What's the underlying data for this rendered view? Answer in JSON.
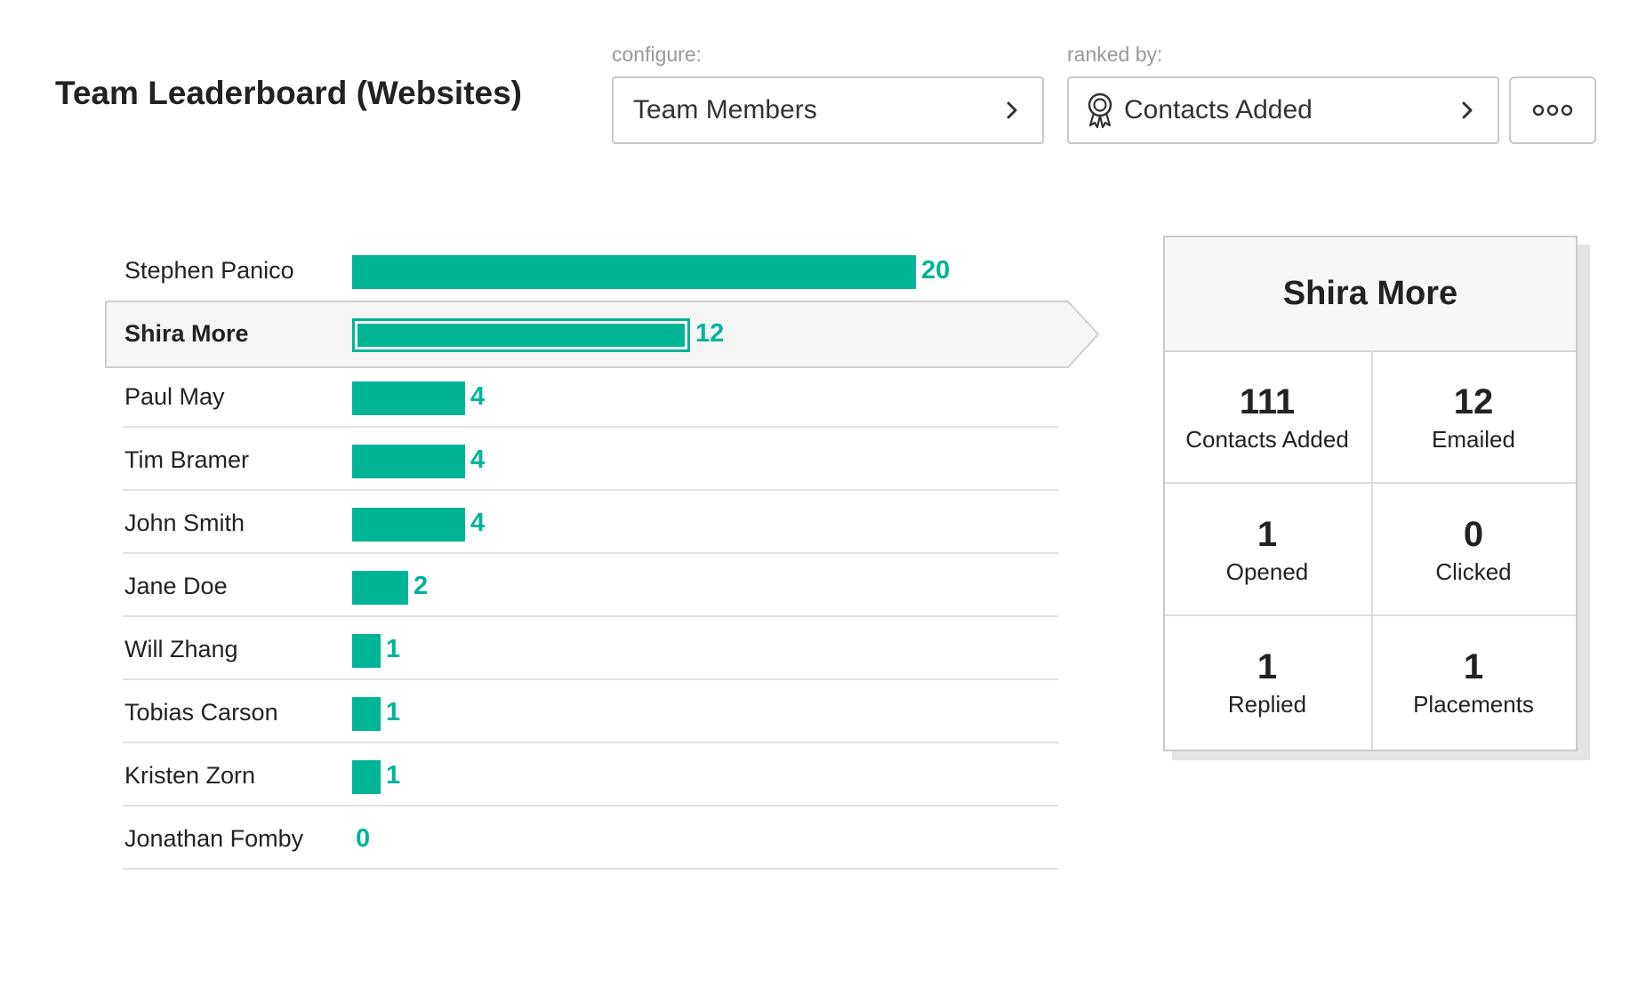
{
  "header": {
    "title": "Team Leaderboard (Websites)",
    "configure_label": "configure:",
    "configure_value": "Team Members",
    "ranked_label": "ranked by:",
    "ranked_value": "Contacts Added",
    "ranked_icon": "award-ribbon-icon",
    "more_icon": "more-options-icon"
  },
  "colors": {
    "accent": "#00b496",
    "selected_bg": "#f5f5f5",
    "border": "#c8c8c8"
  },
  "chart_data": {
    "type": "bar",
    "orientation": "horizontal",
    "categories": [
      "Stephen Panico",
      "Shira More",
      "Paul May",
      "Tim Bramer",
      "John Smith",
      "Jane Doe",
      "Will Zhang",
      "Tobias Carson",
      "Kristen Zorn",
      "Jonathan Fomby"
    ],
    "values": [
      20,
      12,
      4,
      4,
      4,
      2,
      1,
      1,
      1,
      0
    ],
    "selected": "Shira More",
    "xlim": [
      0,
      20
    ]
  },
  "card": {
    "title": "Shira More",
    "stats": [
      {
        "value": "111",
        "label": "Contacts Added"
      },
      {
        "value": "12",
        "label": "Emailed"
      },
      {
        "value": "1",
        "label": "Opened"
      },
      {
        "value": "0",
        "label": "Clicked"
      },
      {
        "value": "1",
        "label": "Replied"
      },
      {
        "value": "1",
        "label": "Placements"
      }
    ]
  }
}
